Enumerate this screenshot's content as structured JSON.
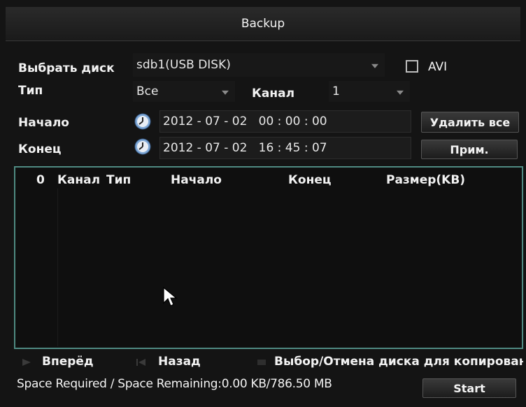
{
  "window": {
    "title": "Backup"
  },
  "disk": {
    "label": "Выбрать диск",
    "selected": "sdb1(USB DISK)",
    "avi_label": "AVI",
    "avi_checked": false
  },
  "type": {
    "label": "Тип",
    "selected": "Все"
  },
  "channel": {
    "label": "Канал",
    "selected": "1"
  },
  "start": {
    "label": "Начало",
    "datetime": "2012 - 07 - 02   00 : 00 : 00"
  },
  "end": {
    "label": "Конец",
    "datetime": "2012 - 07 - 02   16 : 45 : 07"
  },
  "buttons": {
    "delete_all": "Удалить все",
    "apply": "Прим.",
    "start": "Start"
  },
  "table": {
    "columns": [
      "0",
      "Канал",
      "Тип",
      "Начало",
      "Конец",
      "Размер(KB)"
    ],
    "rows": []
  },
  "nav": {
    "forward": "Вперёд",
    "back": "Назад",
    "select": "Выбор/Отмена диска для копирования"
  },
  "status": {
    "text": "Space Required / Space Remaining:0.00 KB/786.50 MB"
  },
  "colors": {
    "list_border": "#4f8a82",
    "background": "#141414"
  },
  "icons": {
    "clock": "clock-icon",
    "dropdown": "chevron-down-icon",
    "cursor": "mouse-pointer-icon"
  }
}
